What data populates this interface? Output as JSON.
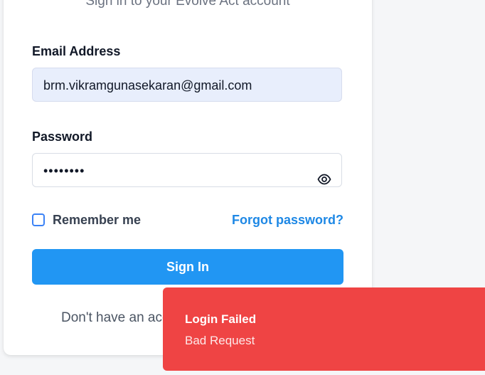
{
  "login": {
    "subtitle": "Sign in to your Evolve Act account",
    "email": {
      "label": "Email Address",
      "value": "brm.vikramgunasekaran@gmail.com"
    },
    "password": {
      "label": "Password",
      "masked_value": "••••••••"
    },
    "remember_label": "Remember me",
    "remember_checked": false,
    "forgot_label": "Forgot password?",
    "signin_label": "Sign In",
    "signup_prompt": "Don't have an account?"
  },
  "toast": {
    "title": "Login Failed",
    "message": "Bad Request",
    "color": "#ef4444"
  },
  "colors": {
    "primary": "#2196f3",
    "link": "#1e88e5",
    "email_autofill_bg": "#e8eefc"
  },
  "icons": {
    "password_toggle": "eye-icon"
  }
}
